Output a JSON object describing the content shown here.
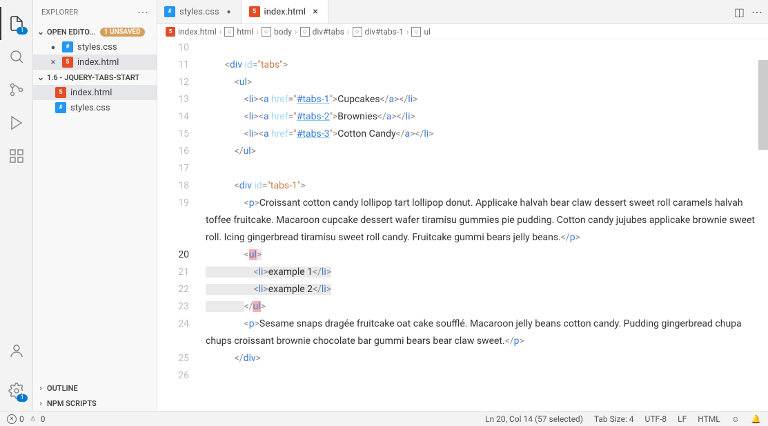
{
  "sidebar": {
    "title": "EXPLORER",
    "open_editors_label": "OPEN EDITO...",
    "unsaved_pill": "1 UNSAVED",
    "open_editors": [
      {
        "name": "styles.css",
        "modified": true,
        "icon": "css"
      },
      {
        "name": "index.html",
        "modified": false,
        "icon": "html"
      }
    ],
    "folder": {
      "name": "1.6 - JQUERY-TABS-START",
      "files": [
        {
          "name": "index.html",
          "icon": "html"
        },
        {
          "name": "styles.css",
          "icon": "css"
        }
      ]
    },
    "outline_label": "OUTLINE",
    "npm_label": "NPM SCRIPTS"
  },
  "activity_badge": "1",
  "gear_badge": "1",
  "tabs": [
    {
      "name": "styles.css",
      "icon": "css",
      "modified": true,
      "active": false
    },
    {
      "name": "index.html",
      "icon": "html",
      "modified": false,
      "active": true
    }
  ],
  "breadcrumb": [
    {
      "icon": "html-file",
      "label": "index.html"
    },
    {
      "icon": "sq",
      "label": "html"
    },
    {
      "icon": "sq",
      "label": "body"
    },
    {
      "icon": "sq",
      "label": "div#tabs"
    },
    {
      "icon": "sq",
      "label": "div#tabs-1"
    },
    {
      "icon": "sq",
      "label": "ul"
    }
  ],
  "code": {
    "first_line_no": 10,
    "lines": [
      {
        "no": 10,
        "text": ""
      },
      {
        "no": 11,
        "html": "        <span class='t-angle'>&lt;</span><span class='t-tag'>div</span> <span class='t-attr'>id</span><span class='t-angle'>=</span><span class='t-str'>\"tabs\"</span><span class='t-angle'>&gt;</span>"
      },
      {
        "no": 12,
        "html": "            <span class='t-angle'>&lt;</span><span class='t-tag'>ul</span><span class='t-angle'>&gt;</span>"
      },
      {
        "no": 13,
        "html": "                <span class='t-angle'>&lt;</span><span class='t-tag'>li</span><span class='t-angle'>&gt;&lt;</span><span class='t-tag'>a</span> <span class='t-attr'>href</span><span class='t-angle'>=</span><span class='t-str'>\"<span class='t-href'>#tabs-1</span>\"</span><span class='t-angle'>&gt;</span><span class='t-link'>Cupcakes</span><span class='t-angle'>&lt;/</span><span class='t-tag'>a</span><span class='t-angle'>&gt;&lt;/</span><span class='t-tag'>li</span><span class='t-angle'>&gt;</span>"
      },
      {
        "no": 14,
        "html": "                <span class='t-angle'>&lt;</span><span class='t-tag'>li</span><span class='t-angle'>&gt;&lt;</span><span class='t-tag'>a</span> <span class='t-attr'>href</span><span class='t-angle'>=</span><span class='t-str'>\"<span class='t-href'>#tabs-2</span>\"</span><span class='t-angle'>&gt;</span><span class='t-link'>Brownies</span><span class='t-angle'>&lt;/</span><span class='t-tag'>a</span><span class='t-angle'>&gt;&lt;/</span><span class='t-tag'>li</span><span class='t-angle'>&gt;</span>"
      },
      {
        "no": 15,
        "html": "                <span class='t-angle'>&lt;</span><span class='t-tag'>li</span><span class='t-angle'>&gt;&lt;</span><span class='t-tag'>a</span> <span class='t-attr'>href</span><span class='t-angle'>=</span><span class='t-str'>\"<span class='t-href'>#tabs-3</span>\"</span><span class='t-angle'>&gt;</span><span class='t-link'>Cotton Candy</span><span class='t-angle'>&lt;/</span><span class='t-tag'>a</span><span class='t-angle'>&gt;&lt;/</span><span class='t-tag'>li</span><span class='t-angle'>&gt;</span>"
      },
      {
        "no": 16,
        "html": "            <span class='t-angle'>&lt;/</span><span class='t-tag'>ul</span><span class='t-angle'>&gt;</span>"
      },
      {
        "no": 17,
        "html": ""
      },
      {
        "no": 18,
        "html": "            <span class='t-angle'>&lt;</span><span class='t-tag'>d<span style='position:relative'>i</span>v</span> <span class='t-attr'>id</span><span class='t-angle'>=</span><span class='t-str'>\"tabs-1\"</span><span class='t-angle'>&gt;</span>"
      },
      {
        "no": 19,
        "wrapped": true,
        "html": "                <span class='t-angle'>&lt;</span><span class='t-tag'>p</span><span class='t-angle'>&gt;</span><span class='t-text'>Croissant cotton candy lollipop tart lollipop donut. Applicake halvah bear claw dessert sweet roll caramels halvah toffee fruitcake. Macaroon cupcake dessert wafer tiramisu gummies pie pudding. Cotton candy jujubes applicake brownie sweet roll. Icing gingerbread tiramisu sweet roll candy. Fruitcake gummi bears jelly beans.</span><span class='t-angle'>&lt;/</span><span class='t-tag'>p</span><span class='t-angle'>&gt;</span>"
      },
      {
        "no": 20,
        "cursor": true,
        "sel": true,
        "html": "                <span class='t-angle'>&lt;</span><span class='t-tag hl'>ul</span><span class='t-angle sel'>&gt;</span>"
      },
      {
        "no": 21,
        "sel": true,
        "html": "<span class='sel'>                    <span class='t-angle'>&lt;</span><span class='t-tag'>li</span><span class='t-angle'>&gt;</span><span class='t-text'>example 1</span><span class='t-angle'>&lt;/</span><span class='t-tag'>li</span><span class='t-angle'>&gt;</span></span>"
      },
      {
        "no": 22,
        "sel": true,
        "html": "<span class='sel'>                    <span class='t-angle'>&lt;</span><span class='t-tag'>li</span><span class='t-angle'>&gt;</span><span class='t-text'>example 2</span><span class='t-angle'>&lt;/</span><span class='t-tag'>li</span><span class='t-angle'>&gt;</span></span>"
      },
      {
        "no": 23,
        "sel": true,
        "html": "<span class='sel'>                </span><span class='t-angle'>&lt;/</span><span class='t-tag hl'>ul</span><span class='t-angle'>&gt;</span>"
      },
      {
        "no": 24,
        "wrapped": true,
        "html": "                <span class='t-angle'>&lt;</span><span class='t-tag'>p</span><span class='t-angle'>&gt;</span><span class='t-text'>Sesame snaps dragée fruitcake oat cake soufflé. Macaroon jelly beans cotton candy. Pudding gingerbread chupa chups croissant brownie chocolate bar gummi bears bear claw sweet.</span><span class='t-angle'>&lt;/</span><span class='t-tag'>p</span><span class='t-angle'>&gt;</span>"
      },
      {
        "no": 25,
        "html": "            <span class='t-angle'>&lt;/</span><span class='t-tag'>div</span><span class='t-angle'>&gt;</span>"
      },
      {
        "no": 26,
        "html": ""
      }
    ]
  },
  "status": {
    "errors": "0",
    "warnings": "0",
    "position": "Ln 20, Col 14 (57 selected)",
    "tabsize": "Tab Size: 4",
    "encoding": "UTF-8",
    "eol": "LF",
    "lang": "HTML"
  }
}
